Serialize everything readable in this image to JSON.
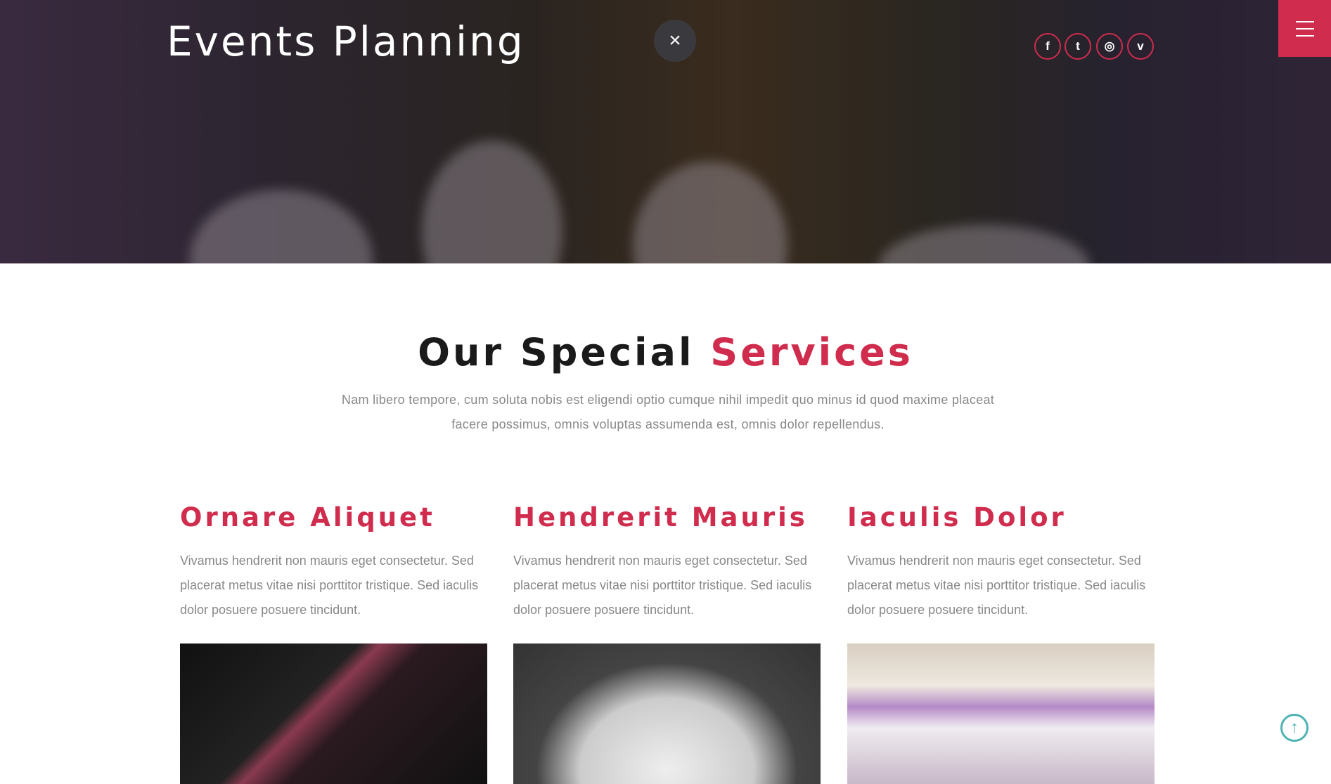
{
  "header": {
    "title": "Events Planning",
    "close_icon": "×",
    "social": [
      {
        "name": "facebook",
        "glyph": "f"
      },
      {
        "name": "twitter",
        "glyph": "t"
      },
      {
        "name": "dribbble",
        "glyph": "◎"
      },
      {
        "name": "vimeo",
        "glyph": "v"
      }
    ]
  },
  "services": {
    "heading_part1": "Our Special",
    "heading_part2": "Services",
    "intro": "Nam libero tempore, cum soluta nobis est eligendi optio cumque nihil impedit quo minus id quod maxime placeat facere possimus, omnis voluptas assumenda est, omnis dolor repellendus.",
    "items": [
      {
        "title": "Ornare Aliquet",
        "text": "Vivamus hendrerit non mauris eget consectetur. Sed placerat metus vitae nisi porttitor tristique. Sed iaculis dolor posuere posuere tincidunt."
      },
      {
        "title": "Hendrerit Mauris",
        "text": "Vivamus hendrerit non mauris eget consectetur. Sed placerat metus vitae nisi porttitor tristique. Sed iaculis dolor posuere posuere tincidunt."
      },
      {
        "title": "Iaculis Dolor",
        "text": "Vivamus hendrerit non mauris eget consectetur. Sed placerat metus vitae nisi porttitor tristique. Sed iaculis dolor posuere posuere tincidunt."
      }
    ]
  },
  "colors": {
    "accent": "#d02c4d",
    "scroll_top": "#4fb3b3"
  },
  "scroll_top_glyph": "↑"
}
